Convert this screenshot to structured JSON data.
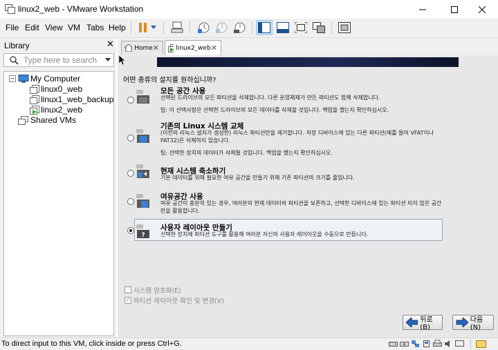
{
  "window": {
    "title": "linux2_web - VMware Workstation",
    "buttons": [
      "minimize",
      "maximize",
      "close"
    ]
  },
  "menu": [
    {
      "label": "File"
    },
    {
      "label": "Edit"
    },
    {
      "label": "View"
    },
    {
      "label": "VM"
    },
    {
      "label": "Tabs"
    },
    {
      "label": "Help"
    }
  ],
  "toolbar": {
    "icons": [
      "pause-icon",
      "dropdown-icon",
      "send-ctrl-alt-del-icon",
      "snapshot-icon",
      "revert-snapshot-icon",
      "snapshot-manager-icon",
      "library-view-icon",
      "console-view-icon",
      "fullscreen-icon",
      "unity-icon",
      "thumbnail-view-icon"
    ]
  },
  "library": {
    "title": "Library",
    "search_placeholder": "Type here to search",
    "tree": {
      "root": "My Computer",
      "children": [
        "linux0_web",
        "linux1_web_backup",
        "linux2_web"
      ],
      "shared": "Shared VMs"
    }
  },
  "tabs": [
    {
      "label": "Home"
    },
    {
      "label": "linux2_web"
    }
  ],
  "installer": {
    "question": "어떤 종류의 설치를 원하십니까?",
    "options": [
      {
        "title": "모든 공간 사용",
        "desc": [
          "선택된 드라이브의 모든 파티션을 삭제합니다. 다른 운영체제가 만든 파티션도 함께 삭제합니다."
        ],
        "tip": "팁: 이 선택사항은 선택한 드라이브의 모든 데이터를 삭제할 것입니다. 백업을 했는지 확인하십시오."
      },
      {
        "title": "기존의 Linux 시스템 교체",
        "desc": [
          "(이전의 리눅스 설치가 생성한) 리눅스 파티션만을 제거합니다. 저장 디바이스에 있는 다른 파티션(예를 들어 VFAT이나",
          "FAT32)은 삭제하지 않습니다."
        ],
        "tip": "팁: 선택한 장치의 데이터가 삭제될 것입니다. 백업을 했는지 확인하십시오."
      },
      {
        "title": "현재 시스템 축소하기",
        "desc": [
          "기본 데이터를 위해 필요한 여유 공간을 만들기 위해 기존 파티션의 크기를 줄입니다."
        ],
        "tip": ""
      },
      {
        "title": "여유공간 사용",
        "desc": [
          "여유 공간이 충분히 있는 경우, 여러분의 현재 데이터와 파티션을 보존하고, 선택한 디바이스에 있는 파티션 되지 않은 공간",
          "만을 활용합니다."
        ],
        "tip": ""
      },
      {
        "title": "사용자 레이아웃 만들기",
        "desc": [
          "선택한 장치에 파티션 도구를 활용해 여러분 자신의 사용자 레이아웃을 수동으로 만듭니다."
        ],
        "tip": ""
      }
    ],
    "selected_index": 4,
    "encrypt_label": "시스템 암호화(E)",
    "review_label": "파티션 레이아웃 확인 및 변경(V)",
    "back_label": "뒤로(B)",
    "next_label": "다음(N)"
  },
  "status": {
    "text": "To direct input to this VM, click inside or press Ctrl+G.",
    "icons": [
      "hdd-icon",
      "cdrom-icon",
      "network-icon",
      "usb-icon",
      "printer-icon",
      "sound-icon",
      "display-icon",
      "message-icon"
    ]
  }
}
